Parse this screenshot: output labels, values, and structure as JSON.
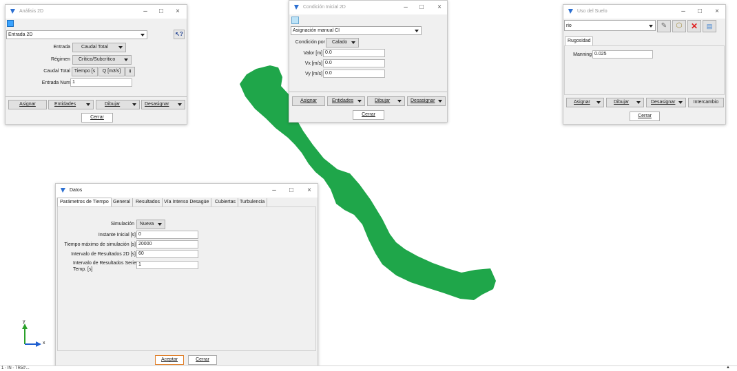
{
  "analisis": {
    "title": "Análisis 2D",
    "combo": "Entrada 2D",
    "entrada_label": "Entrada",
    "entrada_value": "Caudal Total",
    "regimen_label": "Régimen",
    "regimen_value": "Crítico/Subcrítico",
    "caudal_label": "Caudal Total",
    "caudal_tiempo": "Tiempo [s",
    "caudal_q": "Q [m3/s]",
    "entrada_num_label": "Entrada Num",
    "entrada_num_value": "1",
    "asignar": "Asignar",
    "entidades": "Entidades",
    "dibujar": "Dibujar",
    "desasignar": "Desasignar",
    "cerrar": "Cerrar"
  },
  "condicion": {
    "title": "Condición Inicial 2D",
    "combo": "Asignación manual CI",
    "condicion_label": "Condición por",
    "condicion_value": "Calado",
    "valor_label": "Valor [m]",
    "valor_value": "0.0",
    "vx_label": "Vx [m/s]",
    "vx_value": "0.0",
    "vy_label": "Vy [m/s]",
    "vy_value": "0.0",
    "asignar": "Asignar",
    "entidades": "Entidades",
    "dibujar": "Dibujar",
    "desasignar": "Desasignar",
    "cerrar": "Cerrar"
  },
  "uso": {
    "title": "Uso del Suelo",
    "combo": "rio",
    "tab": "Rugosidad",
    "manning_label": "Manning",
    "manning_value": "0.025",
    "asignar": "Asignar",
    "dibujar": "Dibujar",
    "desasignar": "Desasignar",
    "intercambio": "Intercambio",
    "cerrar": "Cerrar"
  },
  "datos": {
    "title": "Datos",
    "tabs": [
      "Parámetros de Tiempo",
      "General",
      "Resultados",
      "Vía Intenso Desagüe",
      "Cubiertas",
      "Turbulencia"
    ],
    "simulacion_label": "Simulación",
    "simulacion_value": "Nueva",
    "instante_label": "Instante Inicial [s]",
    "instante_value": "0",
    "tiempo_label": "Tiempo máximo de simulación [s]",
    "tiempo_value": "20000",
    "int2d_label": "Intervalo de Resultados 2D [s]",
    "int2d_value": "60",
    "intseries_label_1": "Intervalo de Resultados Series",
    "intseries_label_2": "Temp. [s]",
    "intseries_value": "1",
    "aceptar": "Aceptar",
    "cerrar": "Cerrar"
  },
  "status_text": "1 - IN - TR50'...",
  "axis": {
    "x": "x",
    "y": "y"
  },
  "colors": {
    "mesh": "#1fa64a",
    "axis_x": "#1f5fd0",
    "axis_y": "#2aa02a"
  }
}
